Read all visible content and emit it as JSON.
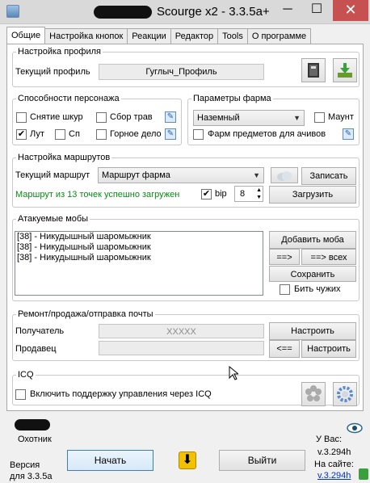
{
  "window": {
    "title": "Scourge x2 - 3.3.5a+",
    "minimize": "─",
    "maximize": "☐",
    "close": "✕"
  },
  "tabs": [
    "Общие",
    "Настройка кнопок",
    "Реакции",
    "Редактор",
    "Tools",
    "О программе"
  ],
  "profile": {
    "legend": "Настройка профиля",
    "label": "Текущий профиль",
    "value": "Гуглыч_Профиль"
  },
  "abilities": {
    "legend": "Способности персонажа",
    "items": [
      {
        "label": "Снятие шкур",
        "checked": false
      },
      {
        "label": "Сбор трав",
        "checked": false
      },
      {
        "label": "Лут",
        "checked": true
      },
      {
        "label": "Сп",
        "checked": false
      },
      {
        "label": "Горное дело",
        "checked": false
      }
    ]
  },
  "farm": {
    "legend": "Параметры фарма",
    "mode": "Наземный",
    "mount_label": "Маунт",
    "mount_checked": false,
    "achiev_label": "Фарм предметов для ачивов",
    "achiev_checked": false
  },
  "routes": {
    "legend": "Настройка маршрутов",
    "label": "Текущий маршрут",
    "value": "Маршрут фарма",
    "record_button": "Записать",
    "status": "Маршрут из 13 точек успешно загружен",
    "bip_label": "bip",
    "bip_checked": true,
    "bip_value": "8",
    "load_button": "Загрузить"
  },
  "mobs": {
    "legend": "Атакуемые мобы",
    "items": [
      "[38] - Никудышный шаромыжник",
      "[38] - Никудышный шаромыжник",
      "[38] - Никудышный шаромыжник"
    ],
    "add_button": "Добавить моба",
    "move_button": "==>",
    "move_all_button": "==> всех",
    "save_button": "Сохранить",
    "hit_others_label": "Бить чужих",
    "hit_others_checked": false
  },
  "mail": {
    "legend": "Ремонт/продажа/отправка почты",
    "receiver_label": "Получатель",
    "receiver_value": "XXXXX",
    "configure_button": "Настроить",
    "seller_label": "Продавец",
    "seller_value": "",
    "back_button": "<==",
    "configure_button2": "Настроить"
  },
  "icq": {
    "legend": "ICQ",
    "enable_label": "Включить поддержку управления через ICQ",
    "enable_checked": false
  },
  "footer": {
    "character_class": "Охотник",
    "version_line1": "Версия",
    "version_line2": "для 3.3.5a",
    "start_button": "Начать",
    "exit_button": "Выйти",
    "you_have_label": "У Вас:",
    "you_have_version": "v.3.294h",
    "on_site_label": "На сайте:",
    "on_site_version": "v.3.294h"
  },
  "colors": {
    "status_green": "#0a8a16",
    "link_blue": "#0033cc",
    "close_red": "#c75050"
  }
}
